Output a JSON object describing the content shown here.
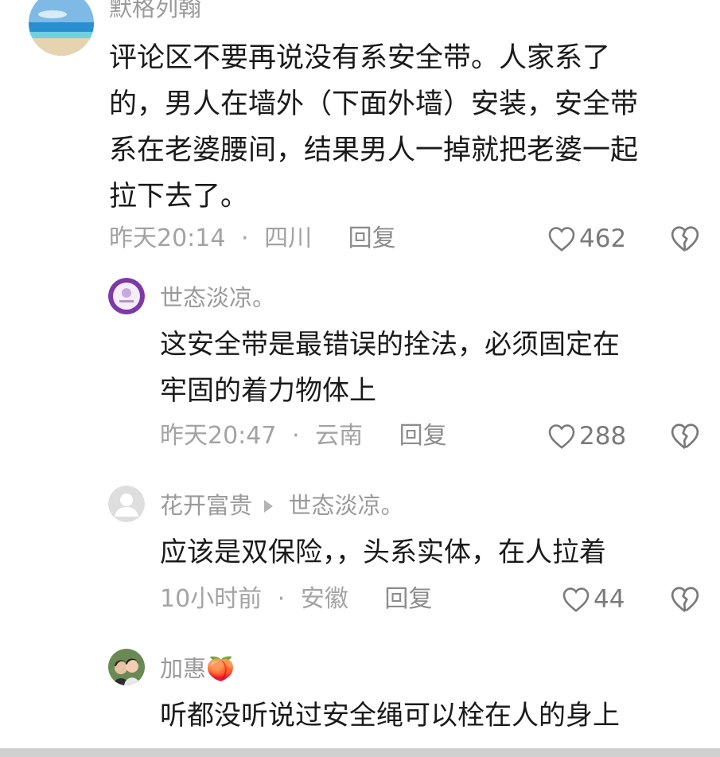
{
  "comments": [
    {
      "username": "默格列翰",
      "text_lines": [
        "评论区不要再说没有系安全带。人家系了",
        "的，男人在墙外（下面外墙）安装，安全带",
        "系在老婆腰间，结果男人一掉就把老婆一起",
        "拉下去了。"
      ],
      "time": "昨天20:14",
      "location": "四川",
      "reply_label": "回复",
      "likes": "462",
      "avatar": "beach-avatar"
    },
    {
      "username": "世态淡凉。",
      "text_lines": [
        "这安全带是最错误的拴法，必须固定在",
        "牢固的着力物体上"
      ],
      "time": "昨天20:47",
      "location": "云南",
      "reply_label": "回复",
      "likes": "288",
      "avatar": "purple-avatar"
    },
    {
      "username": "花开富贵",
      "reply_to": "世态淡凉。",
      "text_lines": [
        "应该是双保险，，头系实体，在人拉着"
      ],
      "time": "10小时前",
      "location": "安徽",
      "reply_label": "回复",
      "likes": "44",
      "avatar": "default-avatar"
    },
    {
      "username": "加惠🍑",
      "text_lines": [
        "听都没听说过安全绳可以栓在人的身上"
      ],
      "avatar": "photo-avatar"
    }
  ],
  "separator": "·",
  "colors": {
    "text": "#1a1a1a",
    "meta": "#a3a3a3",
    "username": "#9a9a9a"
  }
}
